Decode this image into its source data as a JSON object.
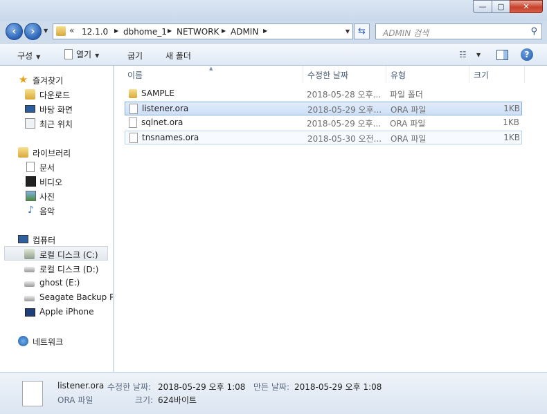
{
  "window": {
    "title_ghost": "",
    "minimize_label": "—",
    "maximize_label": "▢",
    "close_label": "✕"
  },
  "nav": {
    "back": "‹",
    "forward": "›",
    "breadcrumb_prefix": "«",
    "breadcrumbs": [
      "12.1.0",
      "dbhome_1",
      "NETWORK",
      "ADMIN"
    ],
    "search_placeholder": "ADMIN 검색"
  },
  "toolbar": {
    "organize": "구성",
    "open": "열기",
    "burn": "굽기",
    "new_folder": "새 폴더"
  },
  "sidebar": {
    "favorites": {
      "header": "즐겨찾기",
      "items": [
        "다운로드",
        "바탕 화면",
        "최근 위치"
      ]
    },
    "libraries": {
      "header": "라이브러리",
      "items": [
        "문서",
        "비디오",
        "사진",
        "음악"
      ]
    },
    "computer": {
      "header": "컴퓨터",
      "items": [
        "로컬 디스크 (C:)",
        "로컬 디스크 (D:)",
        "ghost (E:)",
        "Seagate Backup Plu",
        "Apple iPhone"
      ]
    },
    "network": {
      "header": "네트워크"
    }
  },
  "columns": {
    "name": "이름",
    "modified": "수정한 날짜",
    "type": "유형",
    "size": "크기"
  },
  "files": [
    {
      "name": "SAMPLE",
      "modified": "2018-05-28 오후...",
      "type": "파일 폴더",
      "size": "",
      "icon": "folder-icon"
    },
    {
      "name": "listener.ora",
      "modified": "2018-05-29 오후...",
      "type": "ORA 파일",
      "size": "1KB",
      "icon": "file-icon"
    },
    {
      "name": "sqlnet.ora",
      "modified": "2018-05-29 오후...",
      "type": "ORA 파일",
      "size": "1KB",
      "icon": "file-icon"
    },
    {
      "name": "tnsnames.ora",
      "modified": "2018-05-30 오전...",
      "type": "ORA 파일",
      "size": "1KB",
      "icon": "file-icon"
    }
  ],
  "details": {
    "filename": "listener.ora",
    "filetype": "ORA 파일",
    "modified_label": "수정한 날짜:",
    "modified_value": "2018-05-29 오후 1:08",
    "created_label": "만든 날짜:",
    "created_value": "2018-05-29 오후 1:08",
    "size_label": "크기:",
    "size_value": "624바이트"
  },
  "colors": {
    "accent": "#2a62b5",
    "selection": "#cddff7"
  }
}
